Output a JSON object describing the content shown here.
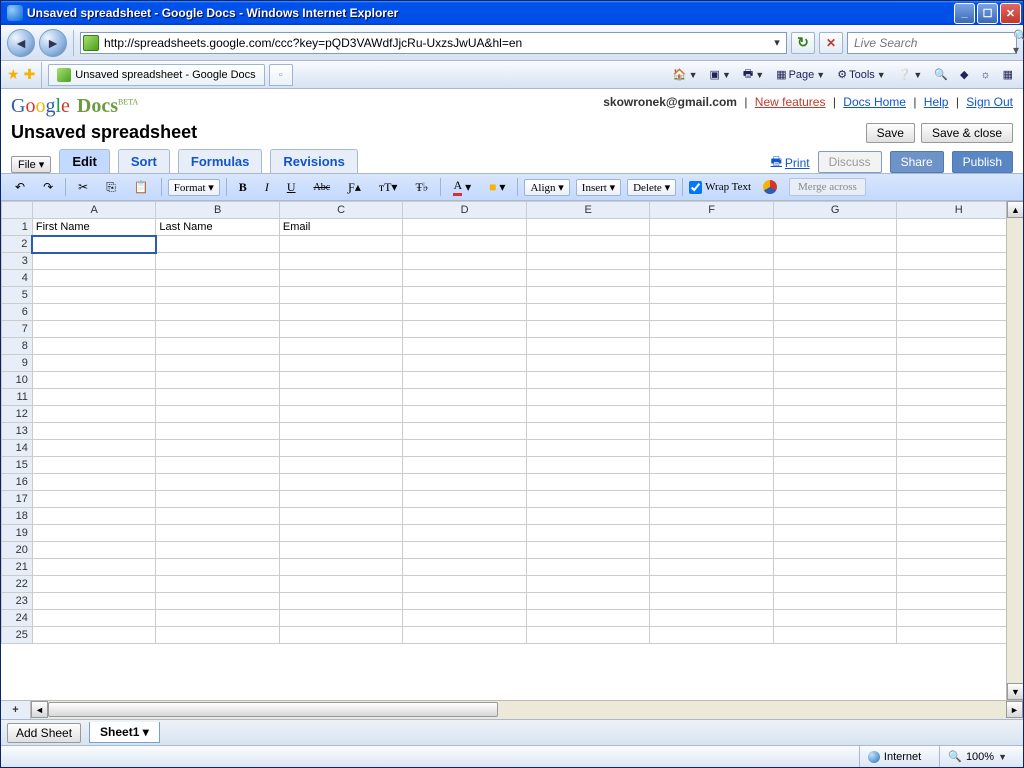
{
  "window": {
    "title": "Unsaved spreadsheet - Google Docs - Windows Internet Explorer",
    "min": "_",
    "max": "☐",
    "close": "✕"
  },
  "nav": {
    "url": "http://spreadsheets.google.com/ccc?key=pQD3VAWdfJjcRu-UxzsJwUA&hl=en",
    "search_placeholder": "Live Search",
    "refresh": "↻",
    "stop": "✕"
  },
  "browser_tab": {
    "label": "Unsaved spreadsheet - Google Docs"
  },
  "ie_menu": {
    "page": "Page",
    "tools": "Tools"
  },
  "header": {
    "user": "skowronek@gmail.com",
    "new_features": "New features",
    "docs_home": "Docs Home",
    "help": "Help",
    "sign_out": "Sign Out"
  },
  "doc": {
    "title": "Unsaved spreadsheet",
    "save": "Save",
    "save_close": "Save & close"
  },
  "menu": {
    "file": "File ▾",
    "tabs": {
      "edit": "Edit",
      "sort": "Sort",
      "formulas": "Formulas",
      "revisions": "Revisions"
    },
    "print": "Print",
    "discuss": "Discuss",
    "share": "Share",
    "publish": "Publish"
  },
  "toolbar": {
    "undo": "↶",
    "redo": "↷",
    "cut": "✂",
    "copy": "⎘",
    "paste": "📋",
    "format": "Format ▾",
    "bold": "B",
    "italic": "I",
    "underline": "U",
    "strike": "Abc",
    "font_size_big": "Ƒ▴",
    "font_size_small": "ᴛT▾",
    "font_family": "Ŧ♭",
    "text_color": "A",
    "bg_color": "■",
    "align": "Align ▾",
    "insert": "Insert ▾",
    "delete": "Delete ▾",
    "wrap": "Wrap Text",
    "merge": "Merge across"
  },
  "grid": {
    "columns": [
      "A",
      "B",
      "C",
      "D",
      "E",
      "F",
      "G",
      "H"
    ],
    "row1": {
      "A": "First Name",
      "B": "Last Name",
      "C": "Email",
      "D": "",
      "E": "",
      "F": "",
      "G": "",
      "H": ""
    },
    "row_count": 25,
    "plus": "+"
  },
  "sheetbar": {
    "add": "Add Sheet",
    "sheet1": "Sheet1 ▾"
  },
  "status": {
    "zone": "Internet",
    "zoom": "100%"
  }
}
